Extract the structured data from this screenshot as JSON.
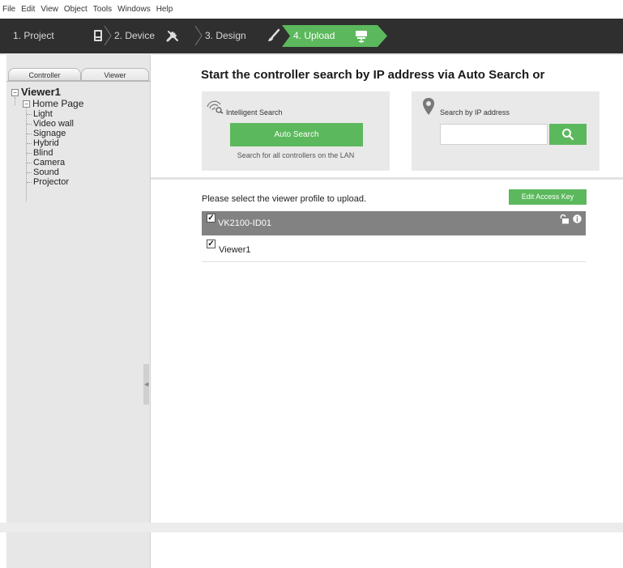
{
  "menu": [
    "File",
    "Edit",
    "View",
    "Object",
    "Tools",
    "Windows",
    "Help"
  ],
  "wizard": {
    "steps": [
      "1. Project",
      "2. Device",
      "3. Design",
      "4. Upload"
    ],
    "active_index": 3,
    "accent_color": "#5cb85c"
  },
  "left_panel": {
    "tabs": [
      "Controller",
      "Viewer"
    ],
    "active_tab": "Viewer",
    "tree": {
      "root": "Viewer1",
      "page": "Home Page",
      "items": [
        "Light",
        "Video wall",
        "Signage",
        "Hybrid",
        "Blind",
        "Camera",
        "Sound",
        "Projector"
      ]
    }
  },
  "main": {
    "headline": "Start the controller search by IP address via Auto Search or",
    "intelligent_search": {
      "title": "Intelligent Search",
      "button": "Auto Search",
      "hint": "Search for all controllers on the LAN"
    },
    "ip_search": {
      "title": "Search by IP address",
      "value": "",
      "placeholder": ""
    },
    "profile_prompt": "Please select the viewer profile to upload.",
    "edit_access_key": "Edit Access Key",
    "device": {
      "name": "VK2100-ID01",
      "checked": true
    },
    "viewer": {
      "name": "Viewer1",
      "checked": true
    }
  }
}
